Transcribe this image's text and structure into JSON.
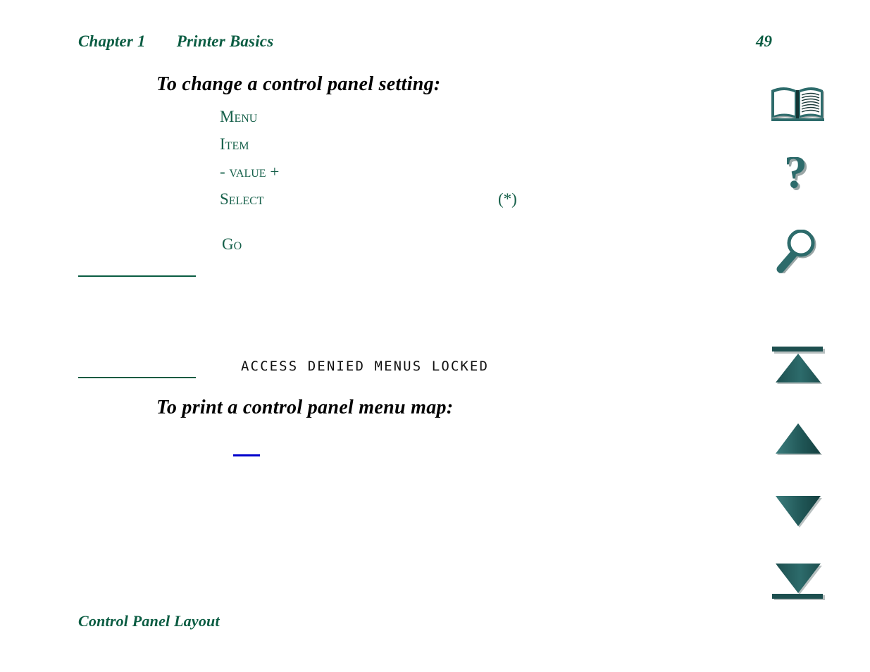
{
  "header": {
    "chapter": "Chapter 1",
    "section": "Printer Basics",
    "page_number": "49"
  },
  "body": {
    "heading_change": "To change a control panel setting:",
    "heading_print": "To print a control panel menu map:",
    "footer_heading": "Control Panel Layout",
    "keys": [
      {
        "name": "Menu",
        "mark": ""
      },
      {
        "name": "Item",
        "mark": ""
      },
      {
        "name": "- Value +",
        "mark": ""
      },
      {
        "name": "Select",
        "mark": "(*)"
      }
    ],
    "key_go": "Go",
    "lcd_message": "ACCESS DENIED MENUS LOCKED"
  },
  "nav_rail": {
    "buttons": [
      {
        "icon": "book-icon",
        "label": "Contents"
      },
      {
        "icon": "question-mark-icon",
        "label": "Help"
      },
      {
        "icon": "magnifying-glass-icon",
        "label": "Search"
      },
      {
        "icon": "triangle-up-bar-icon",
        "label": "First page"
      },
      {
        "icon": "triangle-up-icon",
        "label": "Previous page"
      },
      {
        "icon": "triangle-down-icon",
        "label": "Next page"
      },
      {
        "icon": "triangle-down-bar-icon",
        "label": "Last page"
      }
    ]
  },
  "colors": {
    "heading_green": "#0a5c42",
    "key_green": "#16604a",
    "icon_teal": "#2d6b6b",
    "link_blue": "#0000cc",
    "text_black": "#000000"
  }
}
